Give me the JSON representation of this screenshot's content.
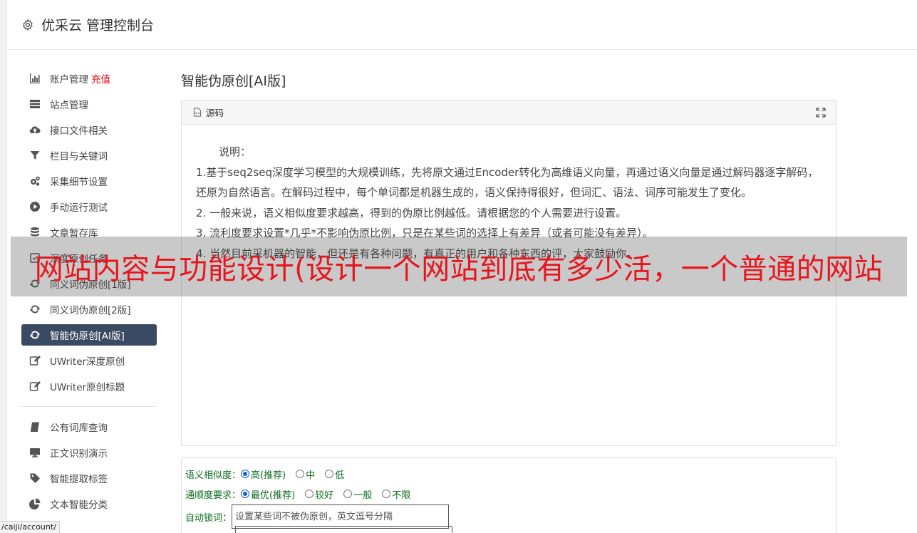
{
  "app": {
    "title": "优采云 管理控制台"
  },
  "sidebar": {
    "items": [
      {
        "label": "账户管理",
        "badge": "充值",
        "icon": "bar-chart-icon"
      },
      {
        "label": "站点管理",
        "icon": "server-icon"
      },
      {
        "label": "接口文件相关",
        "icon": "cloud-upload-icon"
      },
      {
        "label": "栏目与关键词",
        "icon": "filter-icon"
      },
      {
        "label": "采集细节设置",
        "icon": "gears-icon"
      },
      {
        "label": "手动运行测试",
        "icon": "play-circle-icon"
      },
      {
        "label": "文章暂存库",
        "icon": "database-icon"
      },
      {
        "label": "深度原创任务",
        "icon": "task-icon"
      },
      {
        "label": "同义词伪原创[1版]",
        "icon": "refresh-icon"
      },
      {
        "label": "同义词伪原创[2版]",
        "icon": "refresh-icon"
      },
      {
        "label": "智能伪原创[AI版]",
        "icon": "refresh-icon"
      },
      {
        "label": "UWriter深度原创",
        "icon": "edit-icon"
      },
      {
        "label": "UWriter原创标题",
        "icon": "edit-icon"
      },
      {
        "label": "公有词库查询",
        "icon": "book-icon"
      },
      {
        "label": "正文识别演示",
        "icon": "monitor-icon"
      },
      {
        "label": "智能提取标签",
        "icon": "tag-icon"
      },
      {
        "label": "文本智能分类",
        "icon": "pie-chart-icon"
      }
    ]
  },
  "main": {
    "title": "智能伪原创[AI版]",
    "source_header": "源码",
    "description": {
      "intro": "说明：",
      "line1": "1.基于seq2seq深度学习模型的大规模训练，先将原文通过Encoder转化为高维语义向量，再通过语义向量是通过解码器逐字解码，还原为自然语言。在解码过程中，每个单词都是机器生成的，语义保持得很好，但词汇、语法、词序可能发生了变化。",
      "line2": "2. 一般来说，语义相似度要求越高，得到的伪原比例越低。请根据您的个人需要进行设置。",
      "line3": "3. 流利度要求设置*几乎*不影响伪原比例，只是在某些词的选择上有差异（或者可能没有差异）。",
      "line4": "4. 当然目前采机器的智能，但还是有各种问题，有真正的用户和各种东西的评，大家鼓励你。"
    },
    "options": {
      "similarity": {
        "label": "语义相似度：",
        "choices": [
          "高(推荐)",
          "中",
          "低"
        ],
        "selected": 0
      },
      "fluency": {
        "label": "通顺度要求：",
        "choices": [
          "最优(推荐)",
          "较好",
          "一般",
          "不限"
        ],
        "selected": 0
      },
      "lock_words": {
        "label": "自动锁词：",
        "placeholder": "设置某些词不被伪原创，英文逗号分隔"
      }
    }
  },
  "overlay": {
    "text": "网站内容与功能设计(设计一个网站到底有多少活，一个普通的网站"
  },
  "status_bar": {
    "url": "/caiji/account/"
  },
  "colors": {
    "active_nav": "#3b4a63",
    "accent_red": "#e60012",
    "option_green": "#0a6b1c"
  }
}
